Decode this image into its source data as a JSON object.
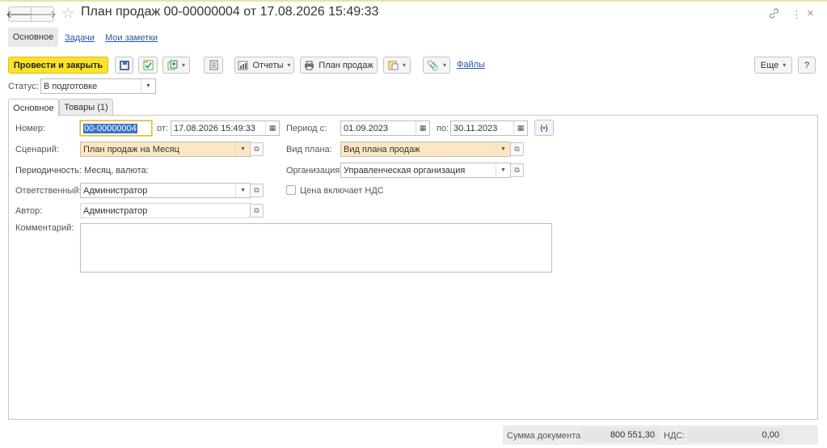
{
  "window": {
    "title": "План продаж 00-00000004 от 17.08.2026 15:49:33",
    "icons": {
      "back": "arrow-left-icon",
      "forward": "arrow-right-icon",
      "favorite": "star-icon",
      "link": "link-icon",
      "more": "kebab-icon",
      "close": "close-icon"
    }
  },
  "function_panel": {
    "items": [
      {
        "label": "Основное",
        "active": true
      },
      {
        "label": "Задачи",
        "active": false
      },
      {
        "label": "Мои заметки",
        "active": false
      }
    ]
  },
  "toolbar": {
    "post_close_label": "Провести и закрыть",
    "reports_label": "Отчеты",
    "print_label": "План продаж",
    "files_label": "Файлы",
    "more_label": "Еще",
    "help_label": "?"
  },
  "status": {
    "label": "Статус:",
    "value": "В подготовке"
  },
  "tabs": [
    {
      "label": "Основное",
      "active": true
    },
    {
      "label": "Товары (1)",
      "active": false
    }
  ],
  "form": {
    "number_label": "Номер:",
    "number_value": "00-00000004",
    "date_label": "от:",
    "date_value": "17.08.2026 15:49:33",
    "period_from_label": "Период с:",
    "period_from_value": "01.09.2023",
    "period_to_label": "по:",
    "period_to_value": "30.11.2023",
    "scenario_label": "Сценарий:",
    "scenario_value": "План продаж на Месяц",
    "plan_type_label": "Вид плана:",
    "plan_type_value": "Вид плана продаж",
    "periodicity_text": "Периодичность: Месяц, валюта:",
    "organization_label": "Организация:",
    "organization_value": "Управленческая организация",
    "responsible_label": "Ответственный:",
    "responsible_value": "Администратор",
    "vat_checkbox_label": "Цена включает НДС",
    "vat_checked": false,
    "author_label": "Автор:",
    "author_value": "Администратор",
    "comment_label": "Комментарий:",
    "comment_value": ""
  },
  "footer": {
    "total_label": "Сумма документа:",
    "total_value": "800 551,30",
    "vat_label": "НДС:",
    "vat_value": "0,00"
  }
}
